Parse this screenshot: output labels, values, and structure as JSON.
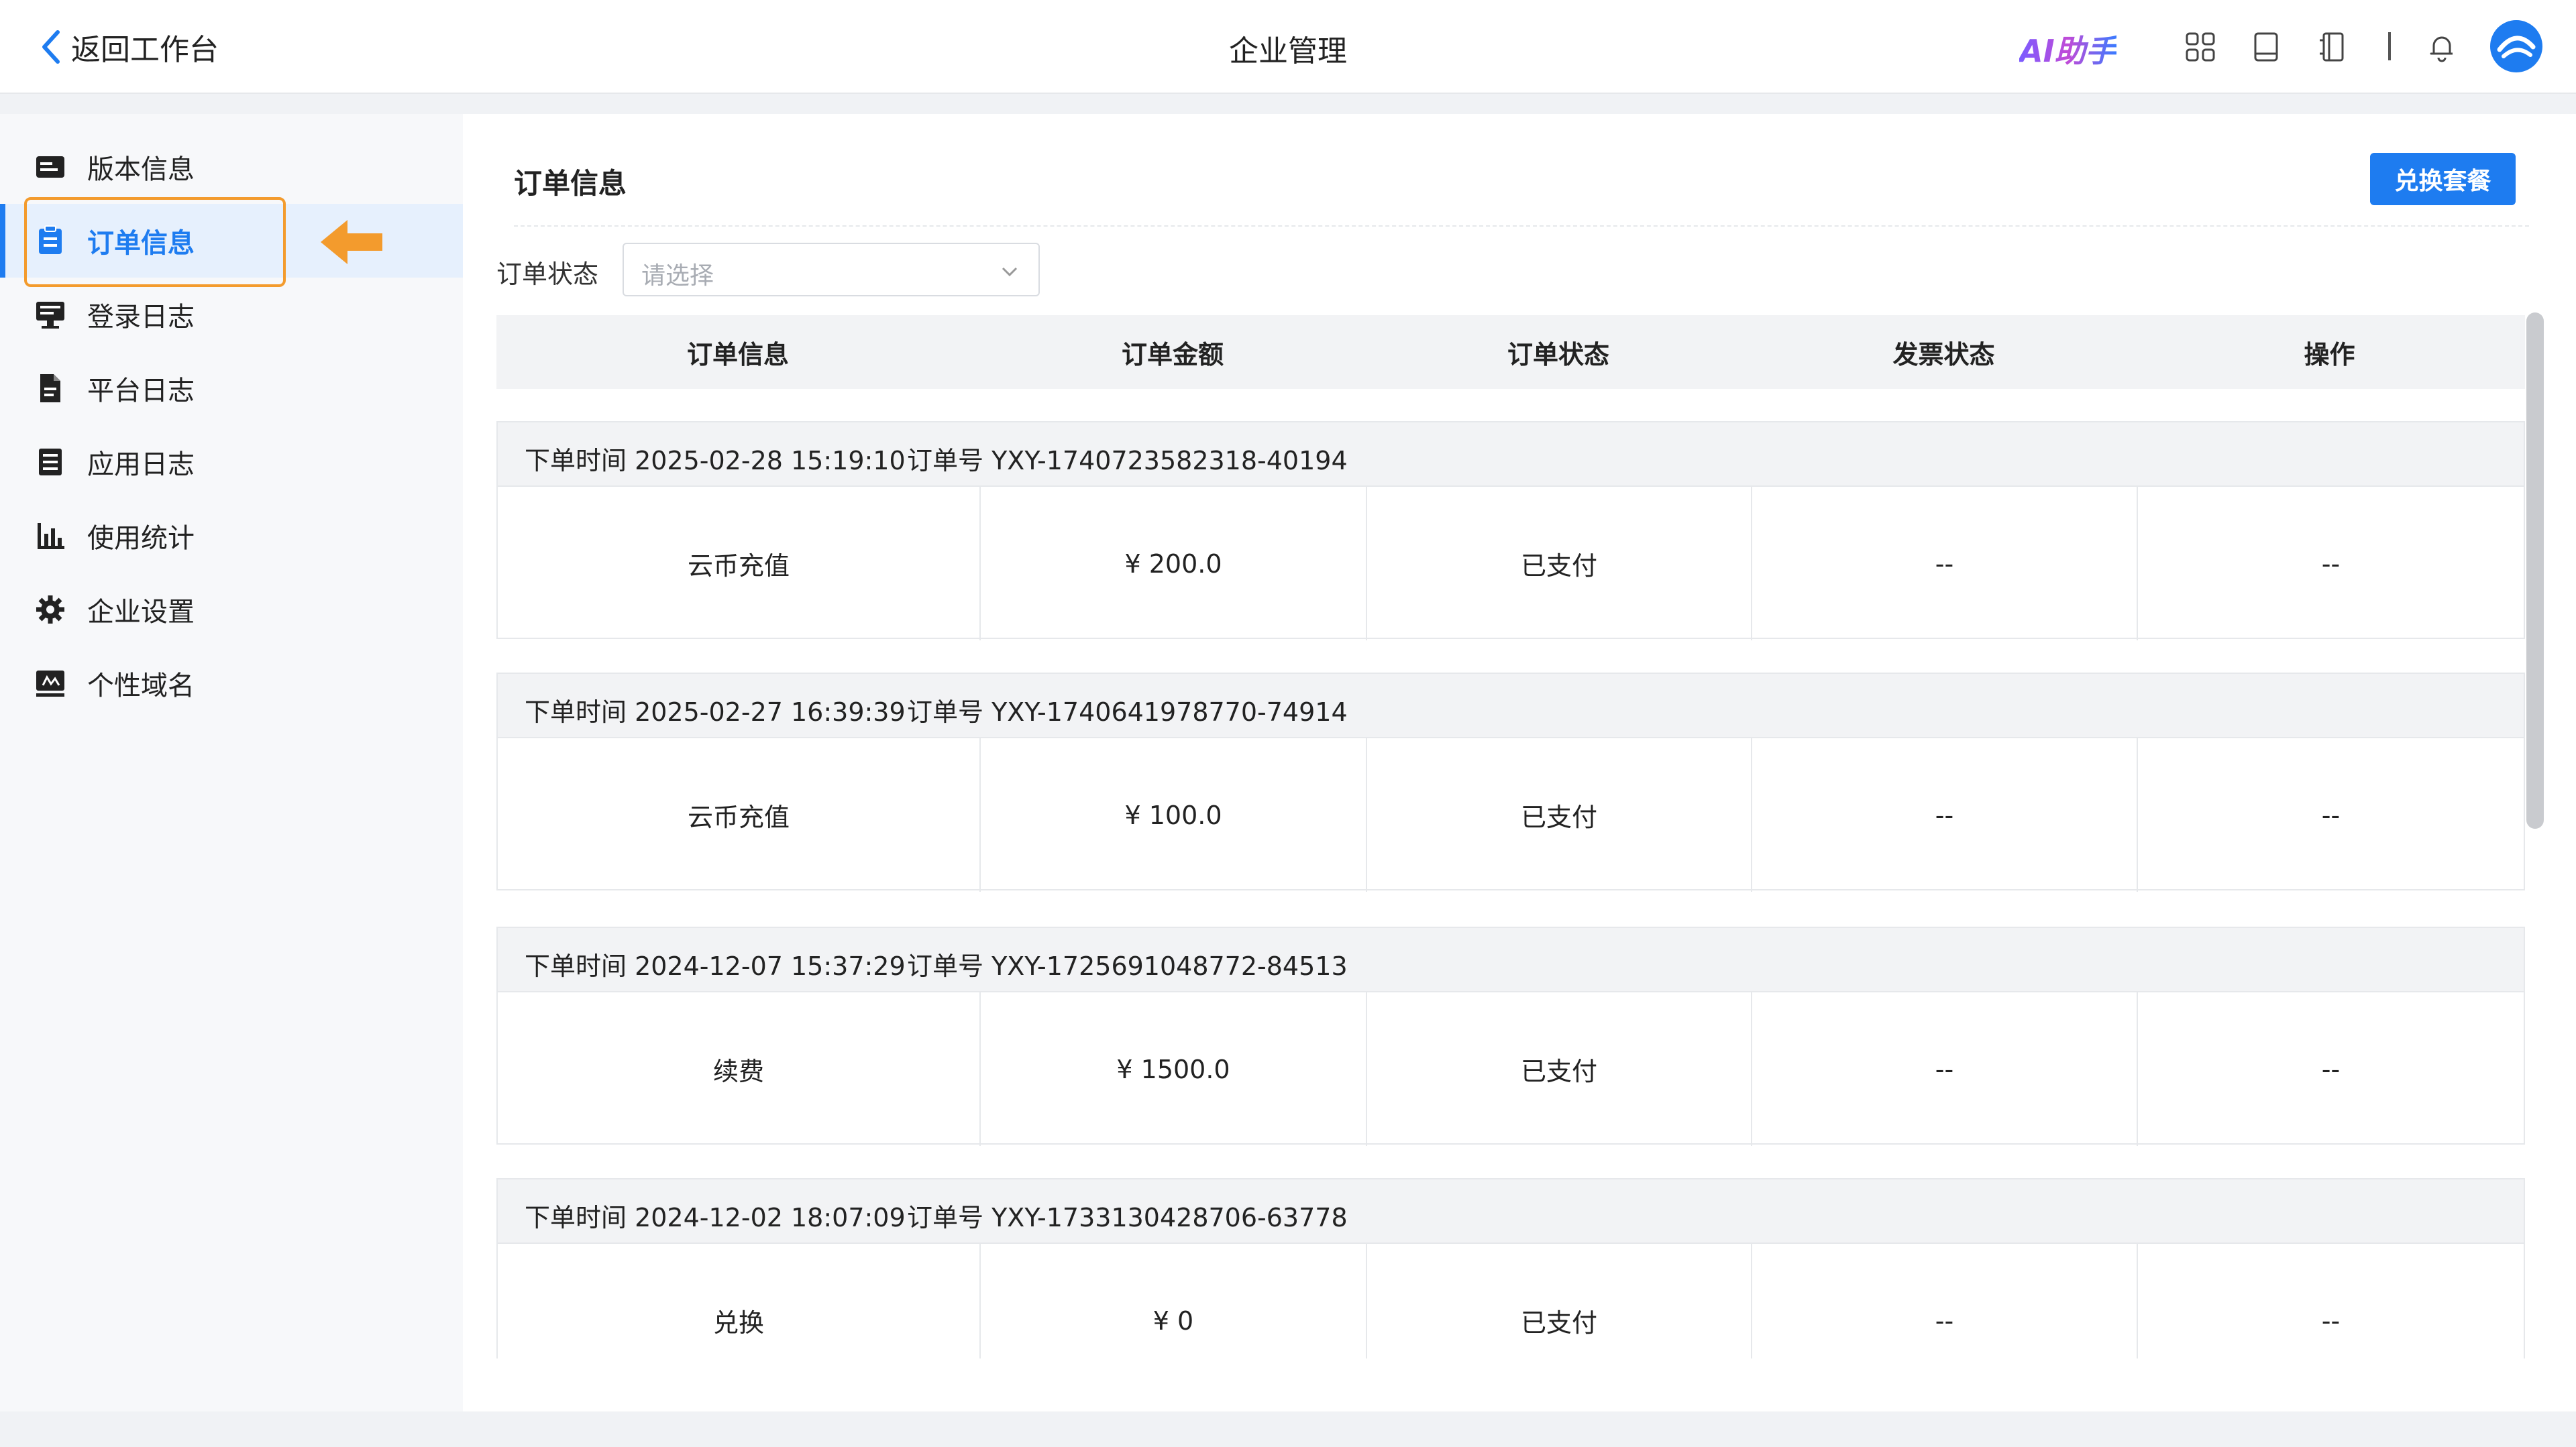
{
  "header": {
    "back_label": "返回工作台",
    "title": "企业管理",
    "ai_label": "AI助手",
    "icons": [
      "apps-icon",
      "book-icon",
      "notebook-icon",
      "bell-icon",
      "avatar"
    ]
  },
  "sidebar": {
    "items": [
      {
        "label": "版本信息",
        "icon": "card-icon",
        "active": false
      },
      {
        "label": "订单信息",
        "icon": "clipboard-icon",
        "active": true
      },
      {
        "label": "登录日志",
        "icon": "monitor-icon",
        "active": false
      },
      {
        "label": "平台日志",
        "icon": "document-icon",
        "active": false
      },
      {
        "label": "应用日志",
        "icon": "list-icon",
        "active": false
      },
      {
        "label": "使用统计",
        "icon": "bar-chart-icon",
        "active": false
      },
      {
        "label": "企业设置",
        "icon": "gear-icon",
        "active": false
      },
      {
        "label": "个性域名",
        "icon": "domain-icon",
        "active": false
      }
    ]
  },
  "content": {
    "title": "订单信息",
    "exchange_button": "兑换套餐",
    "filter": {
      "label": "订单状态",
      "placeholder": "请选择"
    },
    "columns": [
      "订单信息",
      "订单金额",
      "订单状态",
      "发票状态",
      "操作"
    ],
    "orders": [
      {
        "time": "下单时间 2025-02-28 15:19:10",
        "order_no": "订单号 YXY-1740723582318-40194",
        "type": "云币充值",
        "amount": "¥ 200.0",
        "status": "已支付",
        "invoice": "--",
        "action": "--"
      },
      {
        "time": "下单时间 2025-02-27 16:39:39",
        "order_no": "订单号 YXY-1740641978770-74914",
        "type": "云币充值",
        "amount": "¥ 100.0",
        "status": "已支付",
        "invoice": "--",
        "action": "--"
      },
      {
        "time": "下单时间 2024-12-07 15:37:29",
        "order_no": "订单号 YXY-1725691048772-84513",
        "type": "续费",
        "amount": "¥ 1500.0",
        "status": "已支付",
        "invoice": "--",
        "action": "--"
      },
      {
        "time": "下单时间 2024-12-02 18:07:09",
        "order_no": "订单号 YXY-1733130428706-63778",
        "type": "兑换",
        "amount": "¥ 0",
        "status": "已支付",
        "invoice": "--",
        "action": "--"
      }
    ]
  },
  "colors": {
    "primary": "#1e7cf0",
    "highlight": "#f39b2d",
    "active_bg": "#e6f0fd"
  }
}
